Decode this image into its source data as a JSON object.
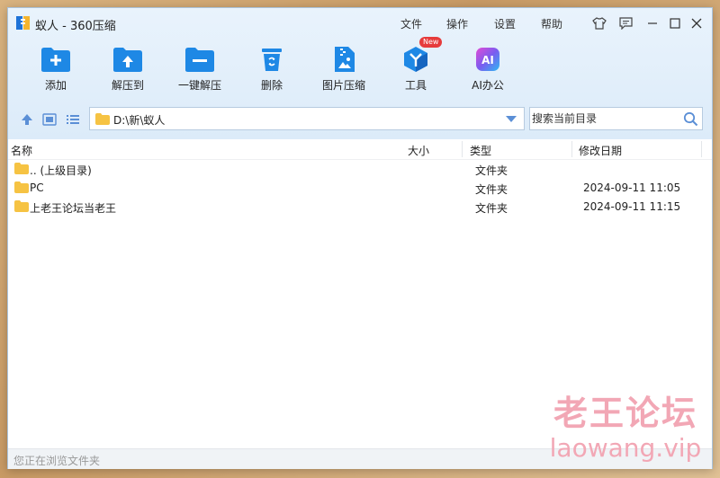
{
  "window": {
    "title": "蚁人 - 360压缩",
    "menu": [
      "文件",
      "操作",
      "设置",
      "帮助"
    ]
  },
  "toolbar": [
    {
      "label": "添加",
      "icon": "add-icon"
    },
    {
      "label": "解压到",
      "icon": "extract-to-icon"
    },
    {
      "label": "一键解压",
      "icon": "one-click-extract-icon"
    },
    {
      "label": "删除",
      "icon": "delete-icon"
    },
    {
      "label": "图片压缩",
      "icon": "image-compress-icon"
    },
    {
      "label": "工具",
      "icon": "tools-icon",
      "badge": "New"
    },
    {
      "label": "AI办公",
      "icon": "ai-office-icon",
      "icon_text": "AI"
    }
  ],
  "nav": {
    "path": "D:\\新\\蚁人",
    "search_placeholder": "搜索当前目录"
  },
  "columns": {
    "name": "名称",
    "size": "大小",
    "type": "类型",
    "date": "修改日期"
  },
  "files": [
    {
      "name": ".. (上级目录)",
      "size": "",
      "type": "文件夹",
      "date": ""
    },
    {
      "name": "PC",
      "size": "",
      "type": "文件夹",
      "date": "2024-09-11 11:05"
    },
    {
      "name": "上老王论坛当老王",
      "size": "",
      "type": "文件夹",
      "date": "2024-09-11 11:15"
    }
  ],
  "status": "您正在浏览文件夹",
  "watermark": {
    "cn": "老王论坛",
    "en": "laowang.vip"
  },
  "colors": {
    "accent": "#1e88e5",
    "folder": "#f6c343",
    "badge": "#e63b3b",
    "watermark": "#f2a7b5"
  }
}
